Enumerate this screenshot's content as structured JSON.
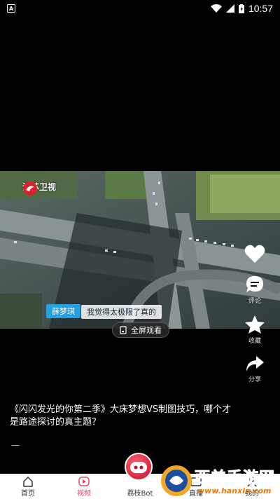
{
  "status_bar": {
    "time": "10:57",
    "notification_icon": "A"
  },
  "video": {
    "channel": "江苏卫视",
    "subtitle_speaker": "薛梦琪",
    "subtitle_line": "我觉得太极限了真的",
    "fullscreen_label": "全屏观看"
  },
  "actions": [
    {
      "icon": "heart-icon",
      "label": ""
    },
    {
      "icon": "comment-icon",
      "label": "评论"
    },
    {
      "icon": "star-icon",
      "label": "收藏"
    },
    {
      "icon": "share-icon",
      "label": "分享"
    }
  ],
  "caption": {
    "title": "《闪闪发光的你第二季》大床梦想VS制图技巧，哪个才是路途探讨的真主题？",
    "extra": "—"
  },
  "nav": {
    "home": "首页",
    "video": "视频",
    "bot": "荔枝Bot",
    "live": "直播",
    "mine": "我的"
  },
  "watermark": {
    "text": "西美手游网",
    "url": "www.hanxin.com"
  },
  "colors": {
    "accent": "#e8406a",
    "subtitle_blue": "#27a0e0"
  }
}
